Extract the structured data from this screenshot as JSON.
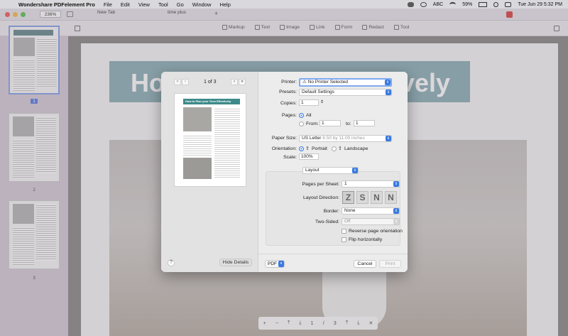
{
  "menubar": {
    "app_name": "Wondershare PDFelement Pro",
    "items": [
      "File",
      "Edit",
      "View",
      "Tool",
      "Go",
      "Window",
      "Help"
    ],
    "battery": "59%",
    "input_source": "ABC",
    "clock": "Tue Jun 29  5:32 PM"
  },
  "tabs": {
    "zoom": "236%",
    "tab1": "New Tab",
    "tab2": "time plus",
    "add": "+"
  },
  "toolbar": {
    "markup": "Markup",
    "text": "Text",
    "image": "Image",
    "link": "Link",
    "form": "Form",
    "redact": "Redact",
    "tool": "Tool"
  },
  "sidebar": {
    "pages": [
      "1",
      "2",
      "3"
    ]
  },
  "document": {
    "banner_left": "How",
    "banner_right": "vely"
  },
  "pagenav": {
    "page": "1",
    "sep": "/",
    "total": "3",
    "plus": "+",
    "minus": "−",
    "close": "✕"
  },
  "dialog": {
    "page_counter": "1 of 3",
    "mini_title": "How to Plan your Time Effectively",
    "help": "?",
    "hide_details": "Hide Details",
    "printer_label": "Printer:",
    "printer_value": "No Printer Selected",
    "presets_label": "Presets:",
    "presets_value": "Default Settings",
    "copies_label": "Copies:",
    "copies_value": "1",
    "pages_label": "Pages:",
    "pages_all": "All",
    "pages_from": "From:",
    "from_value": "1",
    "pages_to": "to:",
    "to_value": "1",
    "paper_label": "Paper Size:",
    "paper_value": "US Letter",
    "paper_dims": "8.50 by 11.00 inches",
    "orientation_label": "Orientation:",
    "portrait": "Portrait",
    "landscape": "Landscape",
    "scale_label": "Scale:",
    "scale_value": "100%",
    "section_value": "Layout",
    "pps_label": "Pages per Sheet:",
    "pps_value": "1",
    "direction_label": "Layout Direction:",
    "direction_glyphs": [
      "Z",
      "S",
      "N",
      "N"
    ],
    "border_label": "Border:",
    "border_value": "None",
    "twosided_label": "Two-Sided:",
    "twosided_value": "Off",
    "reverse_label": "Reverse page orientation",
    "flip_label": "Flip horizontally",
    "pdf_label": "PDF",
    "cancel_label": "Cancel",
    "print_label": "Print"
  }
}
